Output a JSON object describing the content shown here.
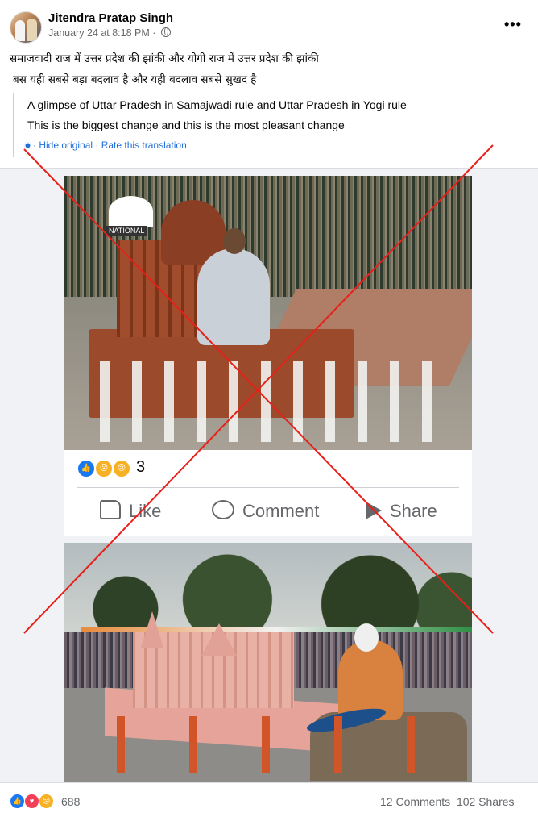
{
  "post": {
    "author": "Jitendra Pratap Singh",
    "timestamp": "January 24 at 8:18 PM",
    "separator": "·",
    "hindi_line1": "समाजवादी राज में उत्तर प्रदेश की झांकी और योगी राज में उत्तर प्रदेश की झांकी",
    "hindi_line2": "बस यही सबसे बड़ा बदलाव है और यही बदलाव सबसे सुखद है",
    "translation_line1": "A glimpse of Uttar Pradesh in Samajwadi rule and Uttar Pradesh in Yogi rule",
    "translation_line2": "This is the biggest change and this is the most pleasant change",
    "hide_original": "· Hide original · Rate this translation"
  },
  "embedded_card": {
    "photo_logo_text": "NATIONAL",
    "reaction_count": "3",
    "actions": {
      "like": "Like",
      "comment": "Comment",
      "share": "Share"
    }
  },
  "footer": {
    "reaction_count": "688",
    "comments": "12 Comments",
    "shares": "102 Shares"
  },
  "colors": {
    "like_blue": "#1877f2",
    "love_red": "#f33e58",
    "wow_yellow": "#f7b125",
    "cross_red": "#e8201a",
    "link_blue": "#216fdb"
  },
  "icons": [
    "globe-icon",
    "more-icon",
    "gear-icon",
    "like-icon",
    "comment-icon",
    "share-icon"
  ]
}
